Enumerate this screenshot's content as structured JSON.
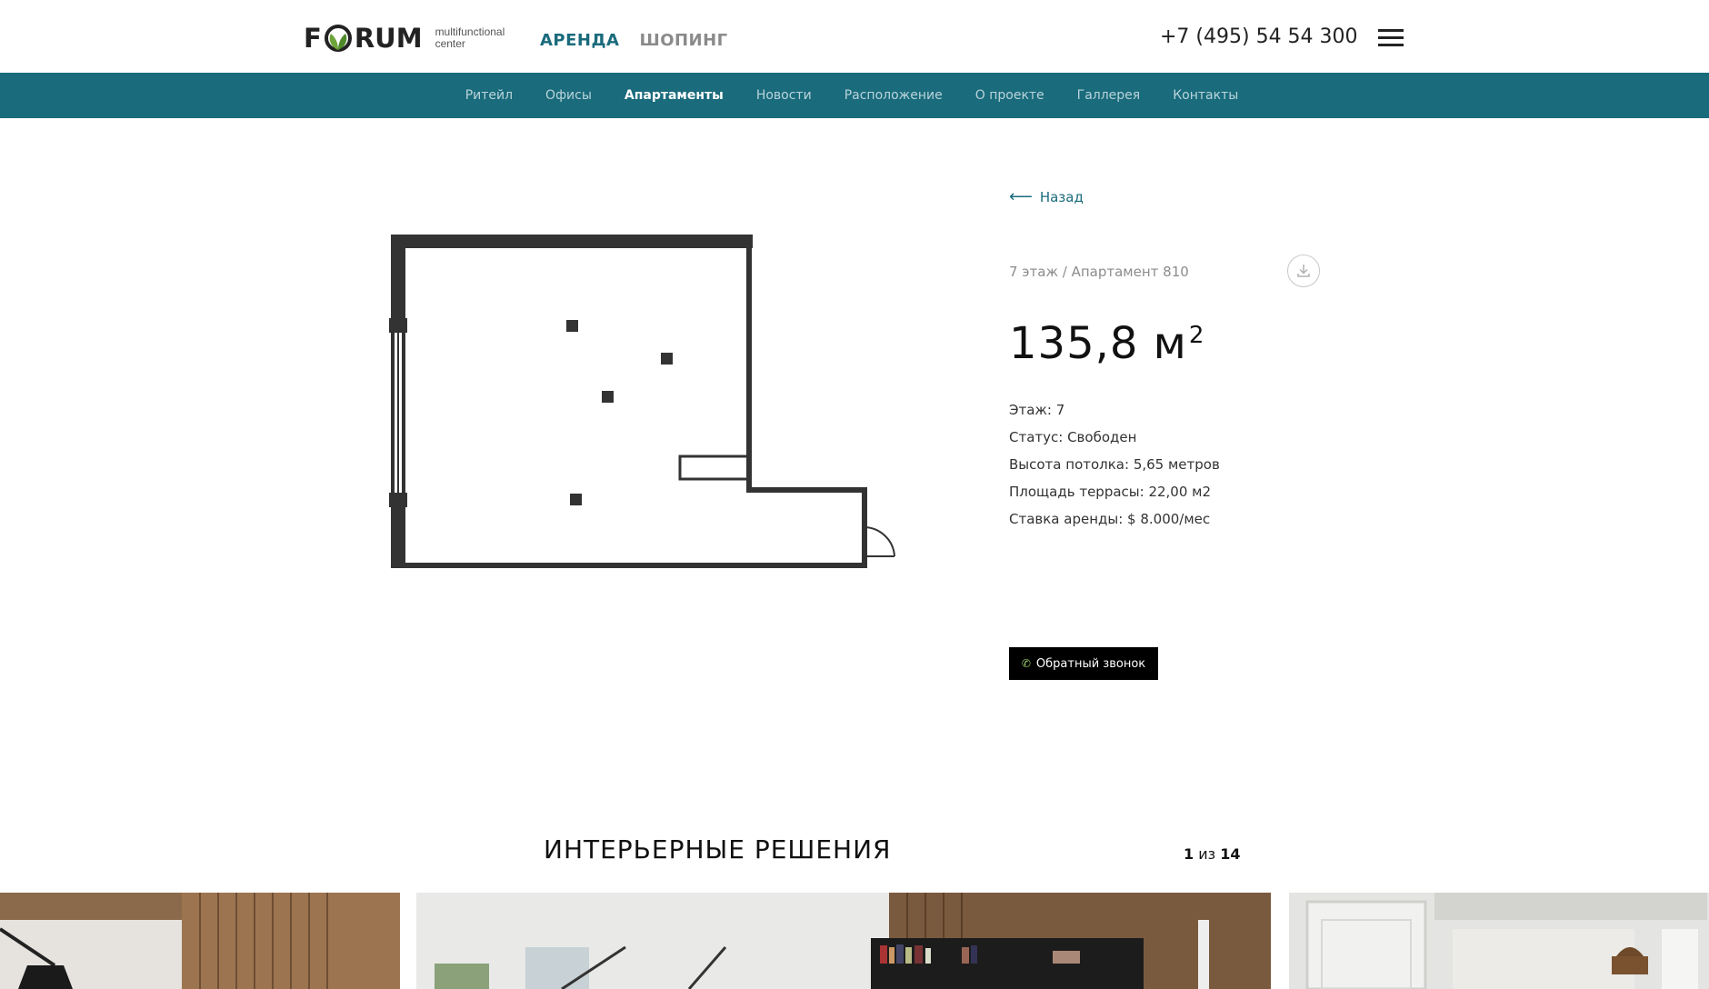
{
  "header": {
    "logo_text_left": "F",
    "logo_text_right": "RUM",
    "logo_sub_line1": "multifunctional",
    "logo_sub_line2": "center",
    "modes": [
      {
        "label": "АРЕНДА",
        "active": true
      },
      {
        "label": "ШОПИНГ",
        "active": false
      }
    ],
    "phone": "+7 (495) 54 54 300",
    "menu_icon": "hamburger-menu-icon"
  },
  "nav": {
    "items": [
      {
        "label": "Ритейл",
        "active": false
      },
      {
        "label": "Офисы",
        "active": false
      },
      {
        "label": "Апартаменты",
        "active": true
      },
      {
        "label": "Новости",
        "active": false
      },
      {
        "label": "Расположение",
        "active": false
      },
      {
        "label": "О проекте",
        "active": false
      },
      {
        "label": "Галлерея",
        "active": false
      },
      {
        "label": "Контакты",
        "active": false
      }
    ]
  },
  "details": {
    "back_label": "Назад",
    "breadcrumb": "7 этаж / Апартамент 810",
    "area_value": "135,8 м",
    "area_sup": "2",
    "specs": [
      "Этаж: 7",
      "Статус: Свободен",
      "Высота потолка: 5,65 метров",
      "Площадь террасы: 22,00 м2",
      "Ставка аренды: $ 8.000/мес"
    ],
    "callback_label": "Обратный звонок",
    "callback_icon": "phone-icon",
    "download_icon": "download-icon"
  },
  "interior": {
    "title": "ИНТЕРЬЕРНЫЕ РЕШЕНИЯ",
    "pager_current": "1",
    "pager_sep": " из ",
    "pager_total": "14"
  },
  "colors": {
    "brand_teal": "#1a6b7c",
    "nav_text": "#b9d4da",
    "leaf_green": "#6ea43a",
    "button_black": "#000000"
  }
}
